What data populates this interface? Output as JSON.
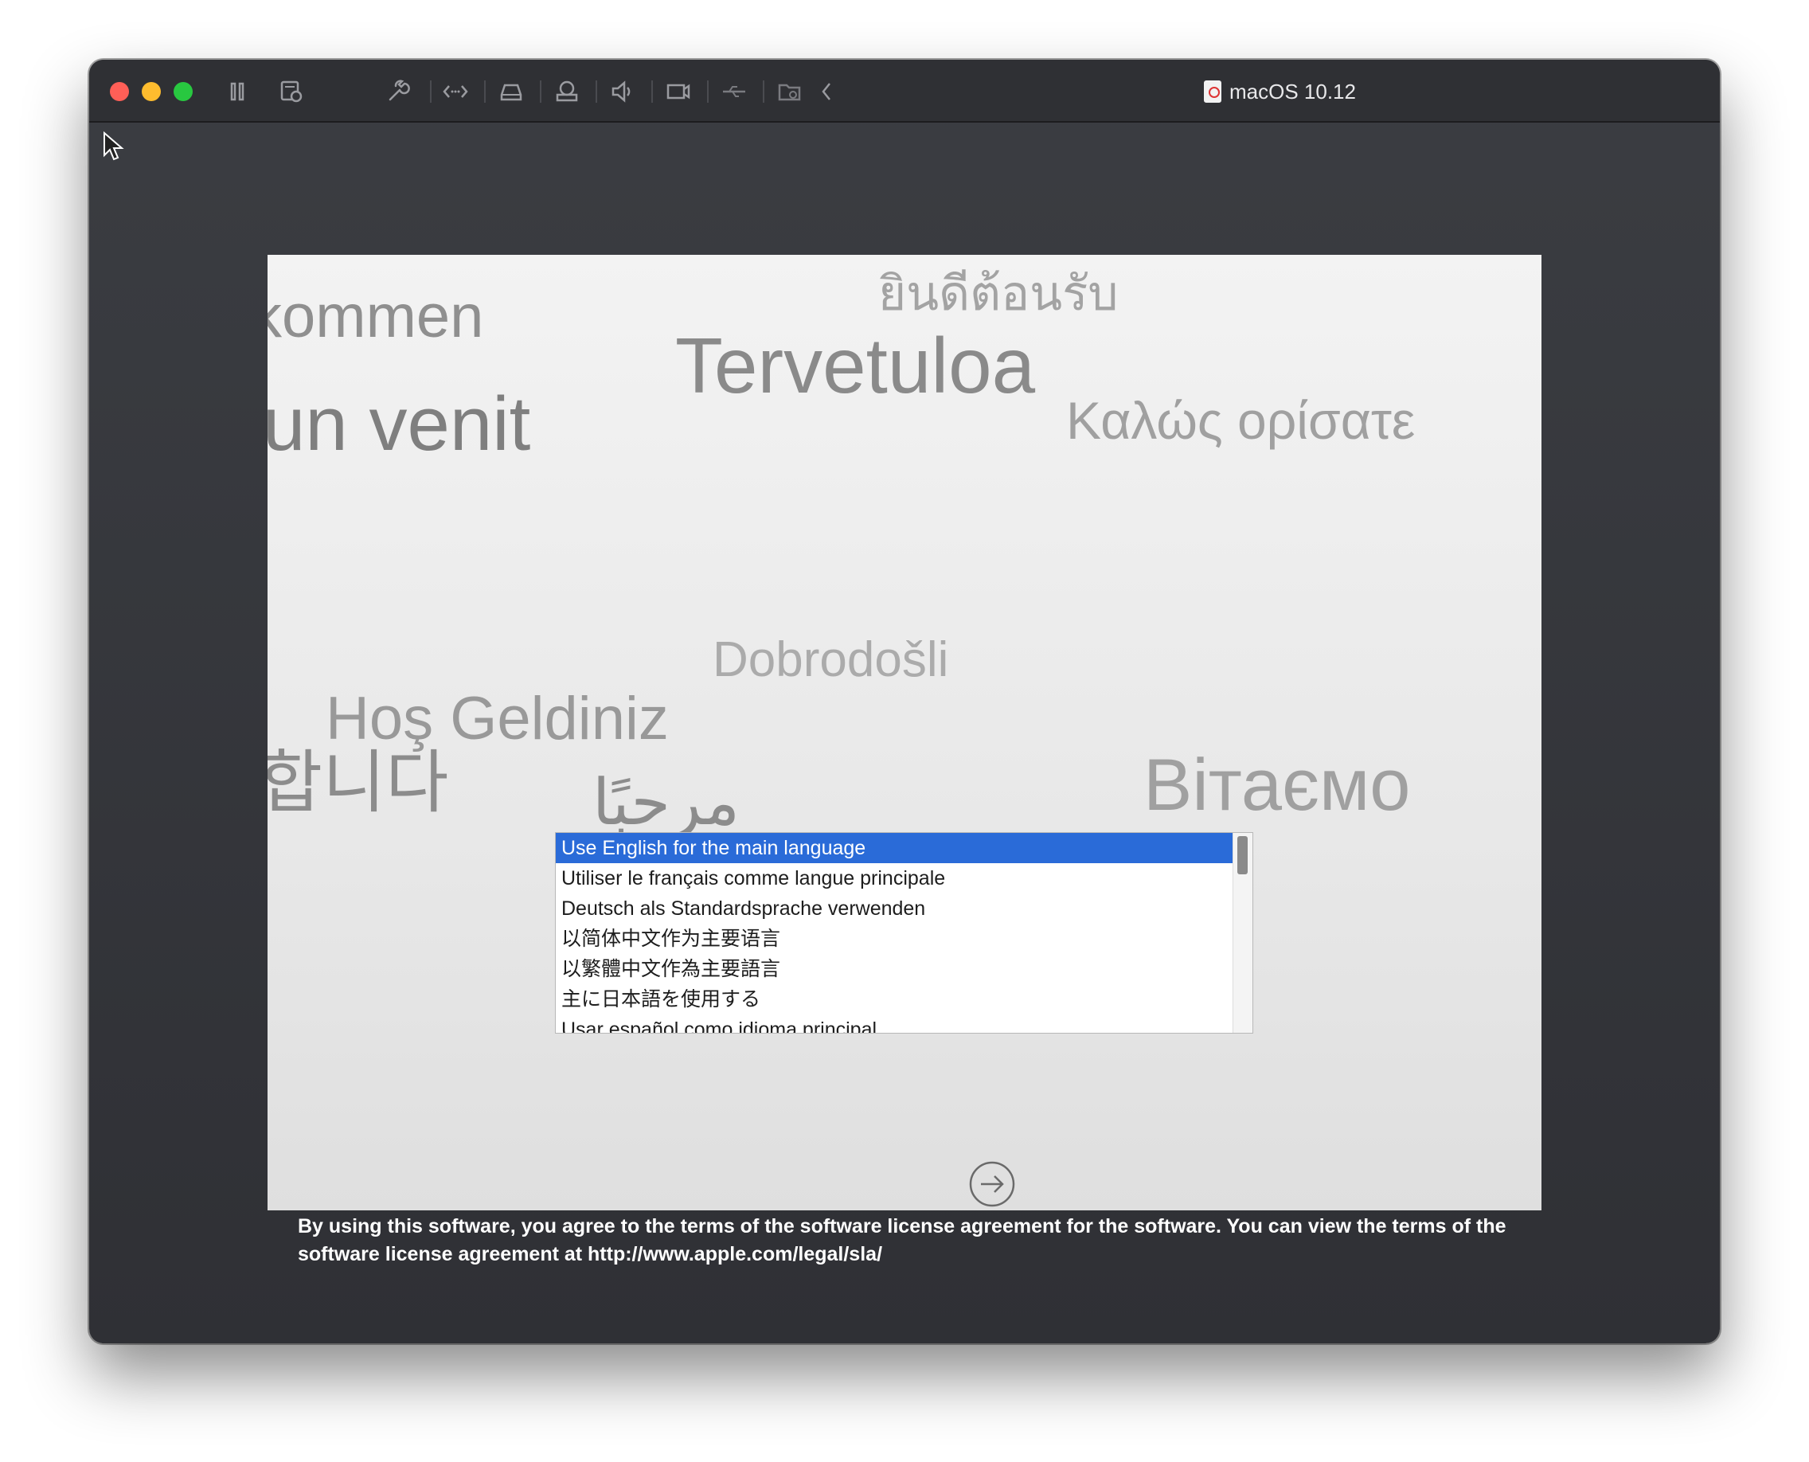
{
  "window": {
    "title": "macOS 10.12"
  },
  "toolbar": {
    "icons": [
      "pause-icon",
      "snapshot-icon",
      "settings-wrench-icon",
      "code-arrows-icon",
      "hard-disk-icon",
      "printer-icon",
      "sound-icon",
      "camera-icon",
      "usb-icon",
      "shared-folder-icon",
      "collapse-chevron-icon"
    ]
  },
  "welcome_words": {
    "w1": "ยินดีต้อนรับ",
    "w2": "kommen",
    "w3": "Tervetuloa",
    "w4": "un venit",
    "w5": "Καλώς ορίσατε",
    "w6": "Dobrodošli",
    "w7": "Hoş Geldiniz",
    "w8": "합니다",
    "w9": "مرحبًا",
    "w10": "Вітаємо"
  },
  "language_list": {
    "selected_index": 0,
    "items": [
      "Use English for the main language",
      "Utiliser le français comme langue principale",
      "Deutsch als Standardsprache verwenden",
      "以简体中文作为主要语言",
      "以繁體中文作為主要語言",
      "主に日本語を使用する",
      "Usar español como idioma principal"
    ]
  },
  "license_text": "By using this software, you agree to the terms of the software license agreement for the software. You can view the terms of the software license agreement at http://www.apple.com/legal/sla/",
  "colors": {
    "selection": "#2a6bd8",
    "close": "#ff5f57",
    "minimize": "#febc2e",
    "zoom": "#28c840"
  }
}
